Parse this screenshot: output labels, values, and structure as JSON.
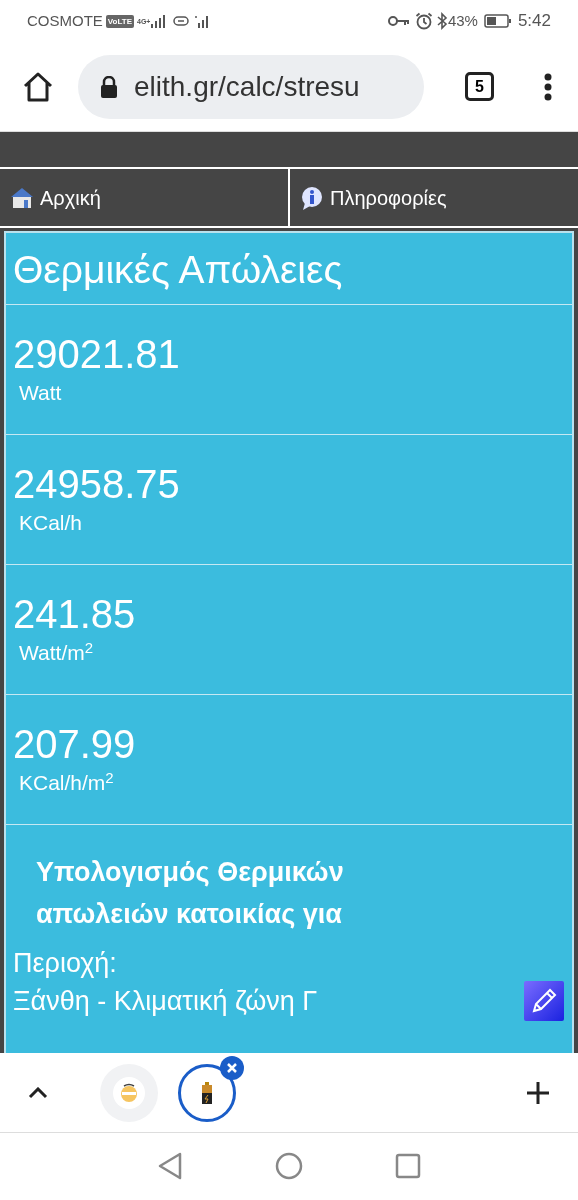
{
  "status_bar": {
    "carrier": "COSMOTE",
    "volte": "VoLTE",
    "network": "4G+",
    "battery": "43%",
    "time": "5:42"
  },
  "browser": {
    "url": "elith.gr/calc/stresu",
    "tab_count": "5"
  },
  "nav": [
    {
      "label": "Αρχική",
      "kind": "home"
    },
    {
      "label": "Πληροφορίες",
      "kind": "info"
    }
  ],
  "panel": {
    "title": "Θερμικές Απώλειες",
    "results": [
      {
        "value": "29021.81",
        "unit": "Watt"
      },
      {
        "value": "24958.75",
        "unit": "KCal/h"
      },
      {
        "value": "241.85",
        "unit": "Watt/m$^{2}$"
      },
      {
        "value": "207.99",
        "unit": "KCal/h/m$^{2}$"
      }
    ],
    "heading": "Υπολογισμός Θερμικών απωλειών κατοικίας για",
    "region_label": "Περιοχή:",
    "region_value": "Ξάνθη - Κλιματική ζώνη Γ"
  },
  "tab_strip": [
    {
      "kind": "face",
      "selected": false
    },
    {
      "kind": "battery",
      "selected": true
    }
  ]
}
